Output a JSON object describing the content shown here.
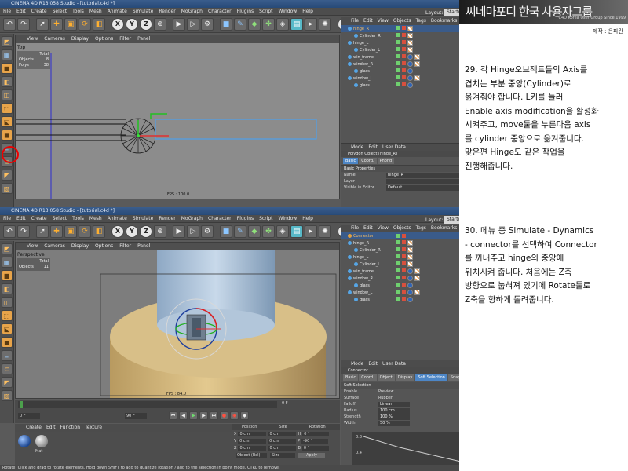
{
  "top_window": {
    "title": "CINEMA 4D R13.058 Studio - [tutorial.c4d *]",
    "menu": [
      "File",
      "Edit",
      "Create",
      "Select",
      "Tools",
      "Mesh",
      "Animate",
      "Simulate",
      "Render",
      "MoGraph",
      "Character",
      "Plugins",
      "Script",
      "Window",
      "Help"
    ],
    "layout_label": "Layout:",
    "layout_value": "Startup",
    "viewport_menu": [
      "View",
      "Cameras",
      "Display",
      "Options",
      "Filter",
      "Panel"
    ],
    "viewport_name": "Top",
    "hud": {
      "total_label": "Total",
      "objects_label": "Objects",
      "objects_value": "8",
      "polys_label": "Polys",
      "polys_value": "38"
    },
    "fps": "FPS : 100.0",
    "object_menu": [
      "File",
      "Edit",
      "View",
      "Objects",
      "Tags",
      "Bookmarks"
    ],
    "objects": [
      {
        "name": "hinge_R",
        "selected": true
      },
      {
        "name": "Cylinder_R",
        "selected": false
      },
      {
        "name": "hinge_L",
        "selected": false
      },
      {
        "name": "Cylinder_L",
        "selected": false
      },
      {
        "name": "win_frame",
        "selected": false
      },
      {
        "name": "window_R",
        "selected": false
      },
      {
        "name": "glass",
        "selected": false
      },
      {
        "name": "window_L",
        "selected": false
      },
      {
        "name": "glass",
        "selected": false
      }
    ],
    "attr_menu": [
      "Mode",
      "Edit",
      "User Data"
    ],
    "attr_title": "Polygon Object [hinge_R]",
    "attr_tabs": [
      "Basic",
      "Coord.",
      "Phong"
    ],
    "attr_section": "Basic Properties",
    "attr_fields": [
      {
        "label": "Name",
        "value": "hinge_R"
      },
      {
        "label": "Layer",
        "value": ""
      },
      {
        "label": "Visible in Editor",
        "value": "Default"
      }
    ]
  },
  "bottom_window": {
    "title": "CINEMA 4D R13.058 Studio - [tutorial.c4d *]",
    "menu": [
      "File",
      "Edit",
      "Create",
      "Select",
      "Tools",
      "Mesh",
      "Animate",
      "Simulate",
      "Render",
      "MoGraph",
      "Character",
      "Plugins",
      "Script",
      "Window",
      "Help"
    ],
    "layout_label": "Layout:",
    "layout_value": "Startup",
    "viewport_menu": [
      "View",
      "Cameras",
      "Display",
      "Options",
      "Filter",
      "Panel"
    ],
    "viewport_name": "Perspective",
    "hud": {
      "total_label": "Total",
      "objects_label": "Objects",
      "objects_value": "11"
    },
    "fps": "FPS : 84.0",
    "object_menu": [
      "File",
      "Edit",
      "View",
      "Objects",
      "Tags",
      "Bookmarks"
    ],
    "objects": [
      {
        "name": "Connector",
        "selected": true
      },
      {
        "name": "hinge_R",
        "selected": false
      },
      {
        "name": "Cylinder_R",
        "selected": false
      },
      {
        "name": "hinge_L",
        "selected": false
      },
      {
        "name": "Cylinder_L",
        "selected": false
      },
      {
        "name": "win_frame",
        "selected": false
      },
      {
        "name": "window_R",
        "selected": false
      },
      {
        "name": "glass",
        "selected": false
      },
      {
        "name": "window_L",
        "selected": false
      },
      {
        "name": "glass",
        "selected": false
      }
    ],
    "attr_menu": [
      "Mode",
      "Edit",
      "User Data"
    ],
    "attr_title": "Connector",
    "attr_tabs": [
      "Basic",
      "Coord.",
      "Object",
      "Display",
      "Soft Selection",
      "Snap Settings"
    ],
    "attr_section": "Soft Selection",
    "attr_fields": [
      {
        "label": "Enable",
        "value": "Preview"
      },
      {
        "label": "Surface",
        "value": "Rubber"
      },
      {
        "label": "Falloff",
        "value": "Linear"
      },
      {
        "label": "Radius",
        "value": "100 cm"
      },
      {
        "label": "Strength",
        "value": "100 %"
      },
      {
        "label": "Width",
        "value": "50 %"
      }
    ],
    "graph_values": [
      "0.8",
      "0.4"
    ],
    "timeline": {
      "start": "0 F",
      "end": "90 F",
      "current": "0 F"
    },
    "material_menu": [
      "Create",
      "Edit",
      "Function",
      "Texture"
    ],
    "material_name": "Mat",
    "coords_headers": [
      "Position",
      "Size",
      "Rotation"
    ],
    "coords_rows": [
      {
        "axis": "X",
        "pos": "0 cm",
        "size": "0 cm",
        "rot_label": "H",
        "rot": "0 °"
      },
      {
        "axis": "Y",
        "pos": "0 cm",
        "size": "0 cm",
        "rot_label": "P",
        "rot": "-90 °"
      },
      {
        "axis": "Z",
        "pos": "0 cm",
        "size": "0 cm",
        "rot_label": "B",
        "rot": "0 °"
      }
    ],
    "coords_mode": "Object (Rel)",
    "coords_size_mode": "Size",
    "apply_label": "Apply",
    "status": "Rotate: Click and drag to rotate elements. Hold down SHIFT to add to quantize rotation / add to the selection in point mode, CTRL to remove."
  },
  "banner": {
    "title": "씨네마포디 한국 사용자그룹",
    "subtitle": "C4D Korea User Group Since 1999"
  },
  "credit": "제작 : 은파란",
  "steps": {
    "step_29": "29. 각 Hinge오브젝트들의 Axis를\n겹치는 부분 중앙(Cylinder)로\n옮겨줘야 합니다. L키를 눌러\nEnable axis modification을 활성화\n시켜주고, move툴을 누른다음 axis\n를 cylinder 중앙으로 옮겨줍니다.\n맞은편 Hinge도 같은 작업을\n진행해줍니다.",
    "step_30": "30. 메뉴 중 Simulate - Dynamics\n- connector를 선택하여 Connector\n를 꺼내주고 hinge의 중앙에\n위치시켜 줍니다. 처음에는 Z축\n방향으로 눕혀져 있기에 Rotate툴로\nZ축을 향하게 돌려줍니다."
  }
}
